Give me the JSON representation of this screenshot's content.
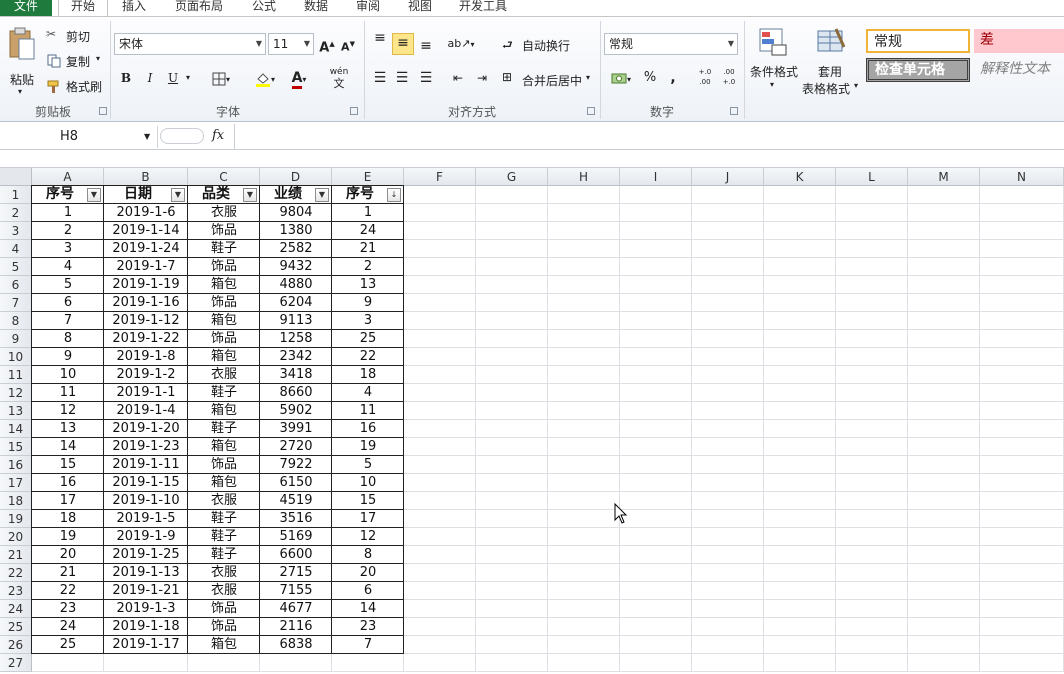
{
  "tabs": [
    {
      "label": "文件"
    },
    {
      "label": "开始"
    },
    {
      "label": "插入"
    },
    {
      "label": "页面布局"
    },
    {
      "label": "公式"
    },
    {
      "label": "数据"
    },
    {
      "label": "审阅"
    },
    {
      "label": "视图"
    },
    {
      "label": "开发工具"
    }
  ],
  "ribbon": {
    "clipboard": {
      "paste": "粘贴",
      "cut": "剪切",
      "copy": "复制",
      "format_painter": "格式刷",
      "label": "剪贴板"
    },
    "font": {
      "name": "宋体",
      "size": "11",
      "bold": "B",
      "italic": "I",
      "underline": "U",
      "label": "字体",
      "wen": "wén"
    },
    "align": {
      "wrap": "自动换行",
      "merge": "合并后居中",
      "label": "对齐方式"
    },
    "number": {
      "format": "常规",
      "percent": "%",
      "comma": ",",
      "inc": "+.0 .00",
      "dec": ".00 +.0",
      "label": "数字"
    },
    "styles": {
      "cond": "条件格式",
      "table1": "套用",
      "table2": "表格格式",
      "normal": "常规",
      "bad": "差",
      "check": "检查单元格",
      "explain": "解释性文本"
    }
  },
  "namebox": "H8",
  "fx": "fx",
  "columns": [
    "A",
    "B",
    "C",
    "D",
    "E",
    "F",
    "G",
    "H",
    "I",
    "J",
    "K",
    "L",
    "M",
    "N"
  ],
  "rows": [
    "1",
    "2",
    "3",
    "4",
    "5",
    "6",
    "7",
    "8",
    "9",
    "10",
    "11",
    "12",
    "13",
    "14",
    "15",
    "16",
    "17",
    "18",
    "19",
    "20",
    "21",
    "22",
    "23",
    "24",
    "25",
    "26",
    "27"
  ],
  "table": {
    "headers": [
      "序号",
      "日期",
      "品类",
      "业绩",
      "序号"
    ],
    "data": [
      [
        "1",
        "2019-1-6",
        "衣服",
        "9804",
        "1"
      ],
      [
        "2",
        "2019-1-14",
        "饰品",
        "1380",
        "24"
      ],
      [
        "3",
        "2019-1-24",
        "鞋子",
        "2582",
        "21"
      ],
      [
        "4",
        "2019-1-7",
        "饰品",
        "9432",
        "2"
      ],
      [
        "5",
        "2019-1-19",
        "箱包",
        "4880",
        "13"
      ],
      [
        "6",
        "2019-1-16",
        "饰品",
        "6204",
        "9"
      ],
      [
        "7",
        "2019-1-12",
        "箱包",
        "9113",
        "3"
      ],
      [
        "8",
        "2019-1-22",
        "饰品",
        "1258",
        "25"
      ],
      [
        "9",
        "2019-1-8",
        "箱包",
        "2342",
        "22"
      ],
      [
        "10",
        "2019-1-2",
        "衣服",
        "3418",
        "18"
      ],
      [
        "11",
        "2019-1-1",
        "鞋子",
        "8660",
        "4"
      ],
      [
        "12",
        "2019-1-4",
        "箱包",
        "5902",
        "11"
      ],
      [
        "13",
        "2019-1-20",
        "鞋子",
        "3991",
        "16"
      ],
      [
        "14",
        "2019-1-23",
        "箱包",
        "2720",
        "19"
      ],
      [
        "15",
        "2019-1-11",
        "饰品",
        "7922",
        "5"
      ],
      [
        "16",
        "2019-1-15",
        "箱包",
        "6150",
        "10"
      ],
      [
        "17",
        "2019-1-10",
        "衣服",
        "4519",
        "15"
      ],
      [
        "18",
        "2019-1-5",
        "鞋子",
        "3516",
        "17"
      ],
      [
        "19",
        "2019-1-9",
        "鞋子",
        "5169",
        "12"
      ],
      [
        "20",
        "2019-1-25",
        "鞋子",
        "6600",
        "8"
      ],
      [
        "21",
        "2019-1-13",
        "衣服",
        "2715",
        "20"
      ],
      [
        "22",
        "2019-1-21",
        "衣服",
        "7155",
        "6"
      ],
      [
        "23",
        "2019-1-3",
        "饰品",
        "4677",
        "14"
      ],
      [
        "24",
        "2019-1-18",
        "饰品",
        "2116",
        "23"
      ],
      [
        "25",
        "2019-1-17",
        "箱包",
        "6838",
        "7"
      ]
    ]
  },
  "colors": {
    "file_tab": "#1f7a3d",
    "bad_style": "#ffc7ce",
    "check_style": "#a5a5a5"
  }
}
